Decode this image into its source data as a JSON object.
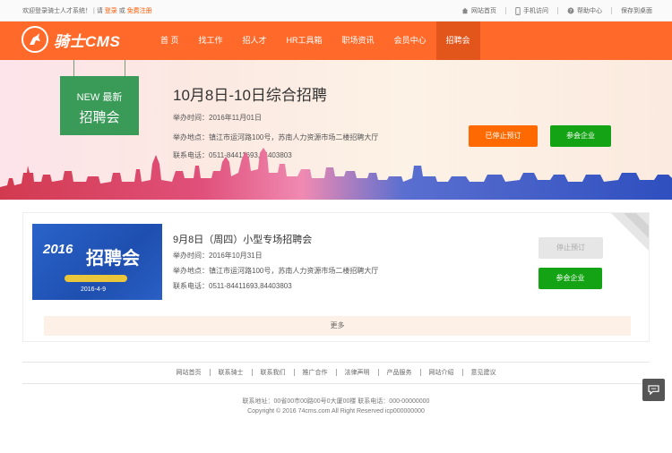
{
  "topbar": {
    "welcome_text": "欢迎登录骑士人才系统！",
    "please": "请",
    "login": "登录",
    "or": "或",
    "register": "免费注册",
    "links": [
      {
        "label": "网站首页",
        "icon": "home-icon"
      },
      {
        "label": "手机访问",
        "icon": "mobile-icon"
      },
      {
        "label": "帮助中心",
        "icon": "help-icon"
      },
      {
        "label": "保存到桌面",
        "icon": ""
      }
    ]
  },
  "header": {
    "logo_text": "骑士CMS",
    "nav": [
      "首 页",
      "找工作",
      "招人才",
      "HR工具箱",
      "职场资讯",
      "会员中心",
      "招聘会"
    ],
    "active_index": 6
  },
  "banner": {
    "sign_line1": "NEW 最新",
    "sign_line2": "招聘会",
    "title": "10月8日-10日综合招聘",
    "date": "举办时间：2016年11月01日",
    "venue": "举办地点：镇江市运河路100号，苏南人力资源市场二楼招聘大厅",
    "phone": "联系电话：0511-84411693,84403803",
    "btn_stop": "已停止预订",
    "btn_companies": "参会企业"
  },
  "fair": {
    "poster_year": "2016",
    "poster_title": "招聘会",
    "poster_date": "2016-4-9",
    "title": "9月8日（周四）小型专场招聘会",
    "date": "举办时间：2016年10月31日",
    "venue": "举办地点：镇江市运河路100号，苏南人力资源市场二楼招聘大厅",
    "phone": "联系电话：0511-84411693,84403803",
    "btn_stop": "停止预订",
    "btn_companies": "参会企业",
    "more": "更多"
  },
  "footer": {
    "links": [
      "网站首页",
      "联系骑士",
      "联系我们",
      "推广合作",
      "法律声明",
      "产品服务",
      "网站介绍",
      "意见建议"
    ],
    "address": "联系地址：00省00市00路00号0大厦00楼  联系电话：000-00000000",
    "copyright": "Copyright © 2016 74cms.com All Right Reserved icp000000000"
  },
  "colors": {
    "brand_orange": "#ff6a2b",
    "accent_green": "#14a314",
    "button_orange": "#ff6a00"
  }
}
